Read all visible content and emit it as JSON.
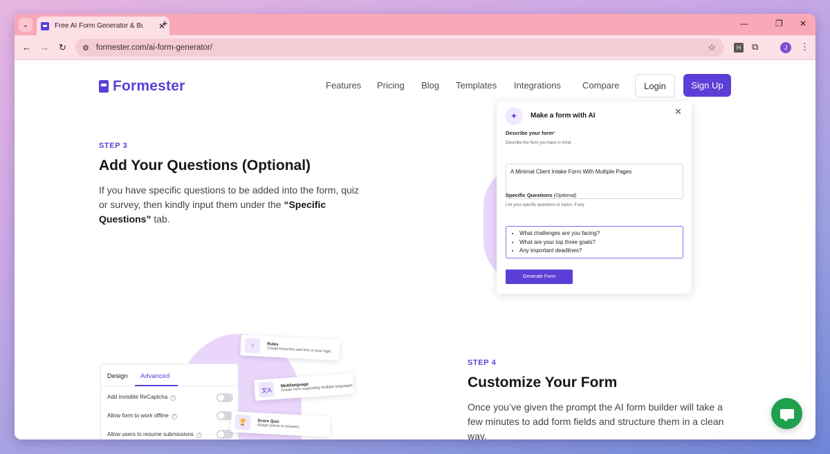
{
  "browser": {
    "tab_title": "Free AI Form Generator & Build",
    "tab_close": "✕",
    "new_tab": "+",
    "url": "formester.com/ai-form-generator/",
    "extension_label": "H",
    "profile_initial": "J"
  },
  "site": {
    "logo_text": "Formester",
    "nav": [
      "Features",
      "Pricing",
      "Blog",
      "Templates",
      "Integrations",
      "Compare"
    ],
    "login_label": "Login",
    "signup_label": "Sign Up"
  },
  "step3": {
    "label": "STEP 3",
    "title": "Add Your Questions (Optional)",
    "desc_pre": "If you have specific questions to be added into the form, quiz or survey, then kindly input them under the ",
    "desc_bold": "“Specific Questions”",
    "desc_post": " tab."
  },
  "ai_card": {
    "title": "Make a form with AI",
    "describe_label": "Describe your form",
    "required_mark": "*",
    "describe_help": "Describe the form you have in mind.",
    "describe_value": "A Minimal Client Intake Form With Multiple Pages",
    "questions_label": "Specific Questions",
    "questions_optional": "(Optional)",
    "questions_help": "List your specific questions or topics, if any",
    "questions": [
      "What challenges are you facing?",
      "What are your top three goals?",
      "Any important deadlines?"
    ],
    "generate_label": "Generate Form"
  },
  "settings_panel": {
    "tabs": [
      "Design",
      "Advanced"
    ],
    "options": [
      "Add invisible ReCaptcha",
      "Allow form to work offline",
      "Allow users to resume submissions"
    ]
  },
  "feature_cards": [
    {
      "title": "Rules",
      "sub": "Create branches and fork in your logic"
    },
    {
      "title": "Multilanguage",
      "sub": "Create form supporting multiple languages"
    },
    {
      "title": "Score Quiz",
      "sub": "Assign points to answers"
    }
  ],
  "step4": {
    "label": "STEP 4",
    "title": "Customize Your Form",
    "desc": "Once you’ve given the prompt the AI form builder will take a few minutes to add form fields and structure them in a clean way."
  },
  "colors": {
    "brand": "#5b3fd6",
    "chat": "#1fa04d"
  }
}
